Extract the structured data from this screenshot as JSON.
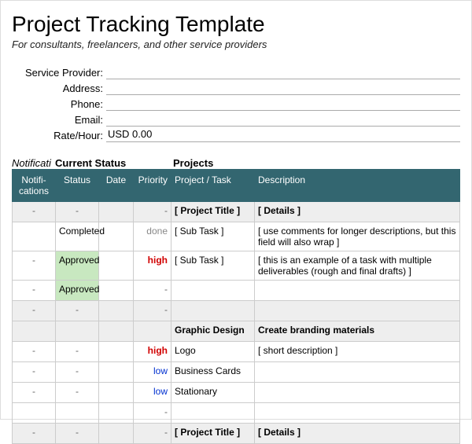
{
  "header": {
    "title": "Project Tracking Template",
    "subtitle": "For consultants, freelancers, and other service providers"
  },
  "info": {
    "labels": {
      "provider": "Service Provider:",
      "address": "Address:",
      "phone": "Phone:",
      "email": "Email:",
      "rate": "Rate/Hour:"
    },
    "values": {
      "provider": "",
      "address": "",
      "phone": "",
      "email": "",
      "rate": "USD 0.00"
    }
  },
  "groups": {
    "notifications": "Notificati",
    "status": "Current Status",
    "projects": "Projects"
  },
  "columns": {
    "notifications": "Notifi-cations",
    "status": "Status",
    "date": "Date",
    "priority": "Priority",
    "project": "Project / Task",
    "description": "Description"
  },
  "rows": [
    {
      "type": "section",
      "notif": "-",
      "status": "-",
      "date": "",
      "priority": "-",
      "project": "[ Project Title ]",
      "desc": "[ Details ]"
    },
    {
      "type": "item",
      "notif": "",
      "status": "Completed",
      "date": "",
      "priority": "done",
      "pri_class": "done",
      "project": "[ Sub Task ]",
      "desc": "[ use comments for longer descriptions, but this field will also wrap ]"
    },
    {
      "type": "item",
      "notif": "-",
      "status": "Approved",
      "status_class": "approved",
      "date": "",
      "priority": "high",
      "pri_class": "high",
      "project": "[ Sub Task ]",
      "desc": "[ this is an example of a task with multiple deliverables (rough and final drafts) ]"
    },
    {
      "type": "item",
      "notif": "-",
      "status": "Approved",
      "status_class": "approved",
      "date": "",
      "priority": "-",
      "project": "",
      "desc": ""
    },
    {
      "type": "blank",
      "notif": "-",
      "status": "-",
      "date": "",
      "priority": "-",
      "project": "",
      "desc": ""
    },
    {
      "type": "section",
      "notif": "",
      "status": "",
      "date": "",
      "priority": "",
      "project": "Graphic Design",
      "desc": "Create branding materials"
    },
    {
      "type": "item",
      "notif": "-",
      "status": "-",
      "date": "",
      "priority": "high",
      "pri_class": "high",
      "project": "Logo",
      "desc": "[ short description ]"
    },
    {
      "type": "item",
      "notif": "-",
      "status": "-",
      "date": "",
      "priority": "low",
      "pri_class": "low",
      "project": "Business Cards",
      "desc": ""
    },
    {
      "type": "item",
      "notif": "-",
      "status": "-",
      "date": "",
      "priority": "low",
      "pri_class": "low",
      "project": "Stationary",
      "desc": ""
    },
    {
      "type": "item",
      "notif": "",
      "status": "",
      "date": "",
      "priority": "-",
      "project": "",
      "desc": ""
    },
    {
      "type": "section",
      "notif": "-",
      "status": "-",
      "date": "",
      "priority": "-",
      "project": "[ Project Title ]",
      "desc": "[ Details ]"
    }
  ]
}
